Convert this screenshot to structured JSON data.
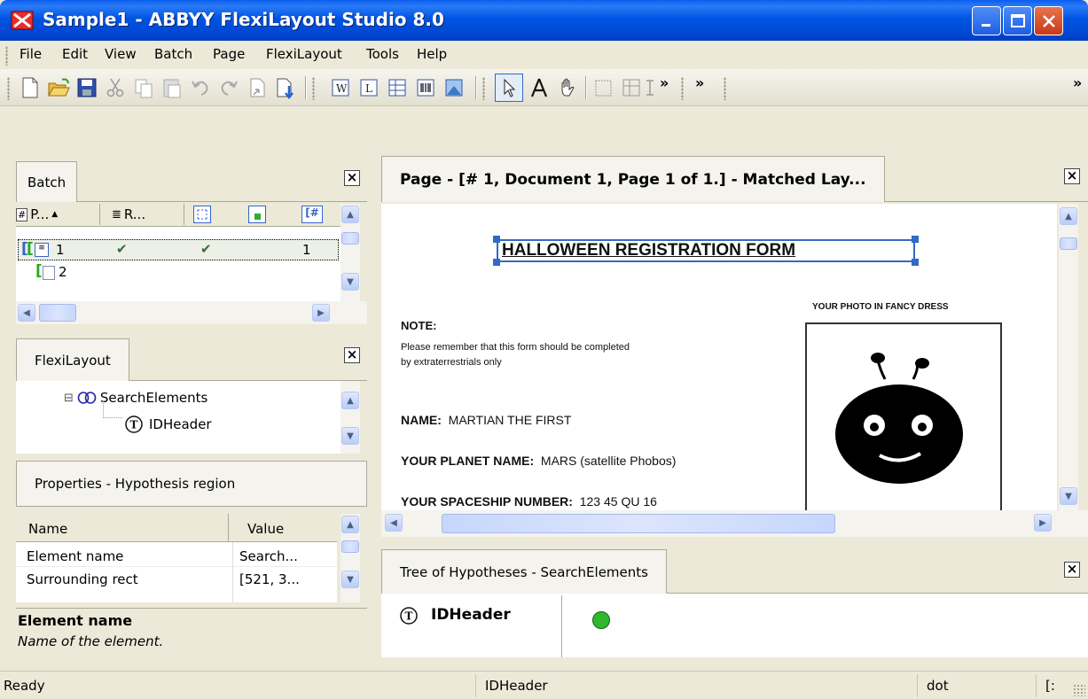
{
  "window": {
    "title": "Sample1 - ABBYY FlexiLayout Studio 8.0"
  },
  "menu": [
    "File",
    "Edit",
    "View",
    "Batch",
    "Page",
    "FlexiLayout",
    "Tools",
    "Help"
  ],
  "toolbar": {
    "overflow": "»"
  },
  "batch_panel": {
    "tab": "Batch",
    "columns": [
      "P...",
      "R..."
    ],
    "rows": [
      {
        "index": "1",
        "check1": "✔",
        "check2": "✔",
        "count": "1",
        "selected": true
      },
      {
        "index": "2",
        "check1": "",
        "check2": "",
        "count": "",
        "selected": false
      }
    ]
  },
  "flexilayout_panel": {
    "tab": "FlexiLayout",
    "tree": [
      {
        "label": "SearchElements",
        "icon": "search-elements-icon",
        "toggle": "⊟"
      },
      {
        "label": "IDHeader",
        "icon": "text-element-icon"
      }
    ]
  },
  "properties_panel": {
    "title": "Properties - Hypothesis region",
    "columns": [
      "Name",
      "Value"
    ],
    "rows": [
      {
        "name": "Element name",
        "value": "Search..."
      },
      {
        "name": "Surrounding rect",
        "value": "[521, 3..."
      }
    ],
    "help_title": "Element name",
    "help_text": "Name of the element."
  },
  "page_panel": {
    "title": "Page - [# 1, Document 1, Page 1 of 1.] - Matched Lay...",
    "document": {
      "heading": "HALLOWEEN REGISTRATION FORM",
      "note_label": "NOTE:",
      "note_line1": "Please remember that this form should be completed",
      "note_line2": "by extraterrestrials only",
      "photo_caption": "YOUR PHOTO IN FANCY DRESS",
      "name_label": "NAME:",
      "name_value": "MARTIAN THE FIRST",
      "planet_label": "YOUR PLANET NAME:",
      "planet_value": "MARS (satellite Phobos)",
      "ship_label": "YOUR SPACESHIP NUMBER:",
      "ship_value": "123 45 QU 16"
    }
  },
  "hypotheses_panel": {
    "tab": "Tree of Hypotheses - SearchElements",
    "item": "IDHeader",
    "status_color": "#2db82d"
  },
  "status": {
    "left": "Ready",
    "middle": "IDHeader",
    "right": "dot",
    "far_right": "[:"
  },
  "colors": {
    "title_bar": "#0054e3",
    "selection": "#316ac5",
    "close_button": "#c8391a"
  }
}
